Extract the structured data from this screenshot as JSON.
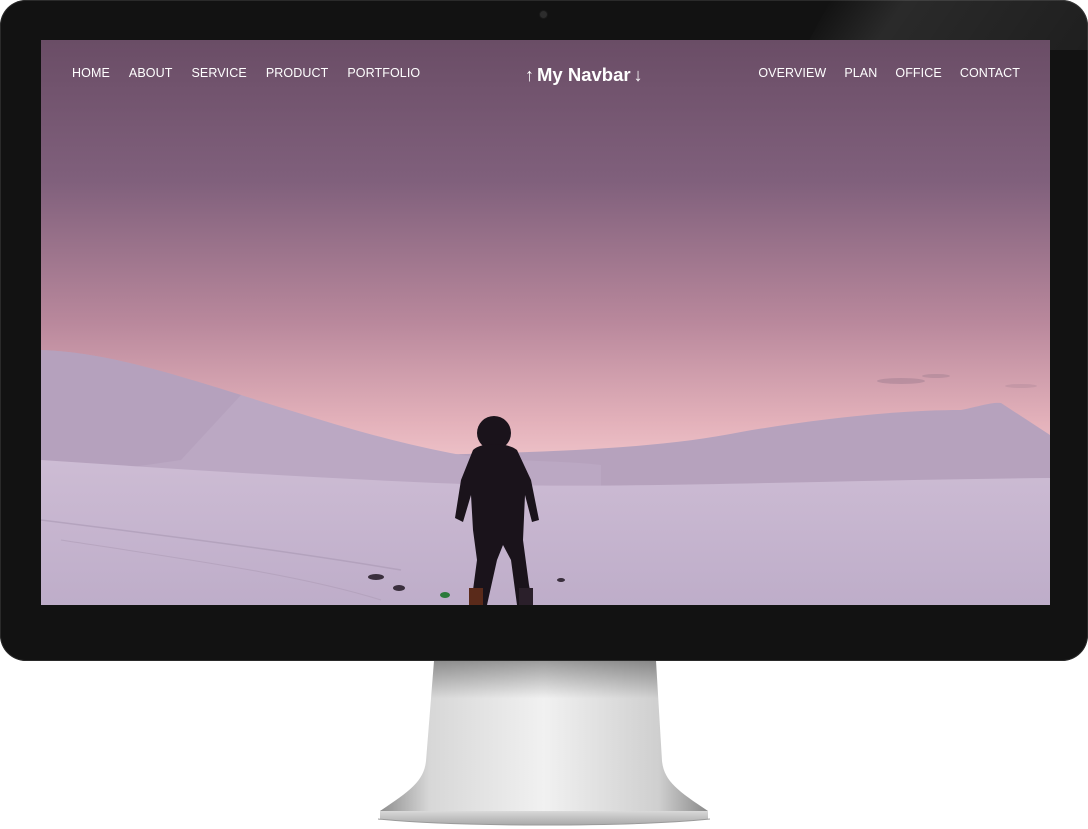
{
  "navbar": {
    "left_items": [
      {
        "label": "HOME"
      },
      {
        "label": "ABOUT"
      },
      {
        "label": "SERVICE"
      },
      {
        "label": "PRODUCT"
      },
      {
        "label": "PORTFOLIO"
      }
    ],
    "brand": {
      "text": "My Navbar",
      "left_icon": "up-arrow-icon",
      "right_icon": "down-arrow-icon"
    },
    "right_items": [
      {
        "label": "OVERVIEW"
      },
      {
        "label": "PLAN"
      },
      {
        "label": "OFFICE"
      },
      {
        "label": "CONTACT"
      }
    ]
  },
  "hero": {
    "image": "snowy-mountain-skier-at-dusk"
  },
  "colors": {
    "sky_top": "#6a4d66",
    "sky_horizon": "#f0c6cc",
    "snow": "#c9b8d3",
    "nav_text": "#ffffff",
    "bezel": "#121212"
  }
}
